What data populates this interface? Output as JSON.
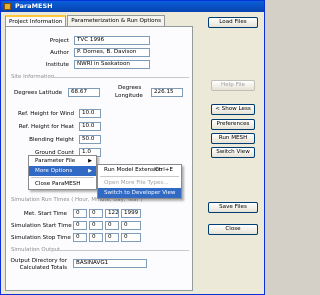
{
  "window": {
    "title": "ParaMESH"
  },
  "tabs": [
    "Project Information",
    "Parameterization & Run Options"
  ],
  "project": {
    "project_label": "Project",
    "project_value": "TVC 1996",
    "author_label": "Author",
    "author_value": "P. Dornes, B. Davison",
    "institute_label": "Institute",
    "institute_value": "NWRI in Saskatoon"
  },
  "site": {
    "section": "Site Information",
    "lat_label": "Degrees Latitude",
    "lat_value": "68.67",
    "lon_label": "Degrees Longitude",
    "lon_value": "226.15",
    "wind_label": "Ref. Height for Wind",
    "wind_value": "10.0",
    "heat_label": "Ref. Height for Heat",
    "heat_value": "10.0",
    "blend_label": "Blending Height",
    "blend_value": "50.0",
    "count_label": "Ground Count",
    "count_value": "1.0"
  },
  "sim": {
    "section": "Simulation Run Times ( Hour, Minute, Day, Year )",
    "met_label": "Met. Start Time",
    "met_values": [
      "0",
      "0",
      "122",
      "1999"
    ],
    "start_label": "Simulation Start Time",
    "start_values": [
      "0",
      "0",
      "0",
      "0"
    ],
    "stop_label": "Simulation Stop Time",
    "stop_values": [
      "0",
      "0",
      "0",
      "0"
    ]
  },
  "output": {
    "section": "Simulation Output",
    "dir_label_1": "Output Directory for",
    "dir_label_2": "Calculated Totals",
    "dir_value": "BASINAVG1"
  },
  "buttons": {
    "load": "Load Files",
    "help": "Help File",
    "show_less": "< Show Less",
    "preferences": "Preferences",
    "run": "Run MESH",
    "switch": "Switch View",
    "save": "Save Files",
    "close": "Close"
  },
  "context_menu": {
    "items": [
      "Parameter File",
      "More Options",
      "Close ParaMESH"
    ]
  },
  "submenu": {
    "run_ext": "Run Model Extension",
    "run_ext_shortcut": "Ctrl+E",
    "open_more": "Open More File Types...",
    "switch_dev": "Switch to Developer View"
  }
}
